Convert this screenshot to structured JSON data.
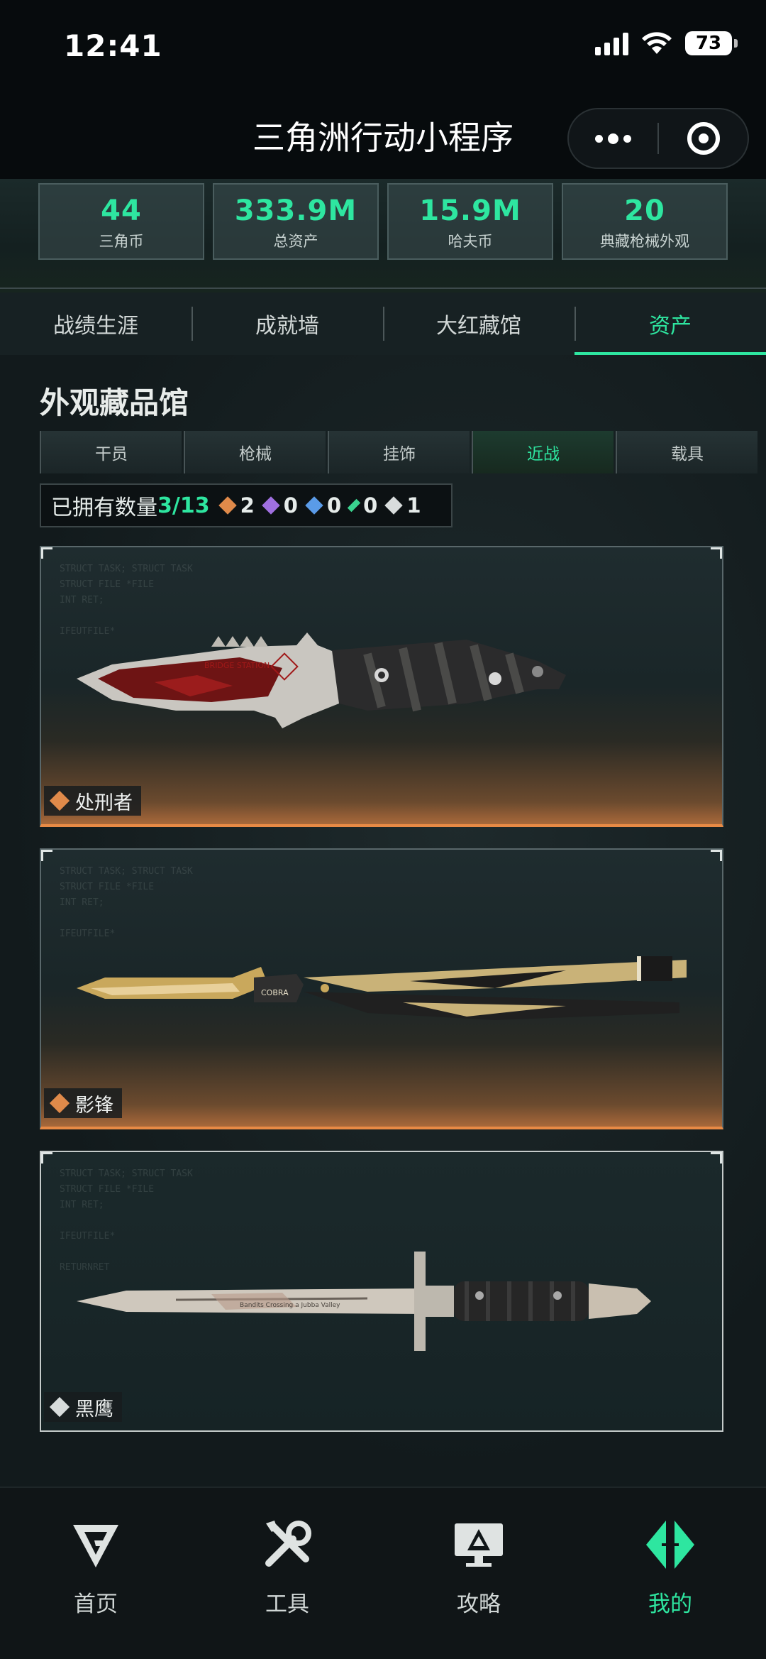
{
  "status_bar": {
    "time": "12:41",
    "battery": "73"
  },
  "title_bar": {
    "title": "三角洲行动小程序"
  },
  "stats": [
    {
      "value": "44",
      "label": "三角币"
    },
    {
      "value": "333.9M",
      "label": "总资产"
    },
    {
      "value": "15.9M",
      "label": "哈夫币"
    },
    {
      "value": "20",
      "label": "典藏枪械外观"
    }
  ],
  "tabs": [
    {
      "label": "战绩生涯",
      "active": false
    },
    {
      "label": "成就墙",
      "active": false
    },
    {
      "label": "大红藏馆",
      "active": false
    },
    {
      "label": "资产",
      "active": true
    }
  ],
  "section": {
    "title": "外观藏品馆"
  },
  "sub_tabs": [
    {
      "label": "干员",
      "active": false
    },
    {
      "label": "枪械",
      "active": false
    },
    {
      "label": "挂饰",
      "active": false
    },
    {
      "label": "近战",
      "active": true
    },
    {
      "label": "载具",
      "active": false
    }
  ],
  "owned": {
    "label": "已拥有数量",
    "count": "3/13",
    "rarities": [
      {
        "color": "#e08a4a",
        "count": "2"
      },
      {
        "color": "#a070e0",
        "count": "0"
      },
      {
        "color": "#5a9be8",
        "count": "0"
      },
      {
        "color": "#3ad38f",
        "count": "0"
      },
      {
        "color": "#d8dcdc",
        "count": "1"
      }
    ]
  },
  "items": [
    {
      "name": "处刑者",
      "rarity_color": "#e08a4a",
      "blade_text": "BRIDGE STATION"
    },
    {
      "name": "影锋",
      "rarity_color": "#e08a4a",
      "blade_text": "COBRA"
    },
    {
      "name": "黑鹰",
      "rarity_color": "#d8dcdc",
      "blade_text": "Bandits Crossing a Jubba Valley"
    }
  ],
  "bottom_nav": [
    {
      "label": "首页",
      "icon": "home-logo-icon",
      "active": false
    },
    {
      "label": "工具",
      "icon": "tools-icon",
      "active": false
    },
    {
      "label": "攻略",
      "icon": "guide-monitor-icon",
      "active": false
    },
    {
      "label": "我的",
      "icon": "profile-logo-icon",
      "active": true
    }
  ]
}
